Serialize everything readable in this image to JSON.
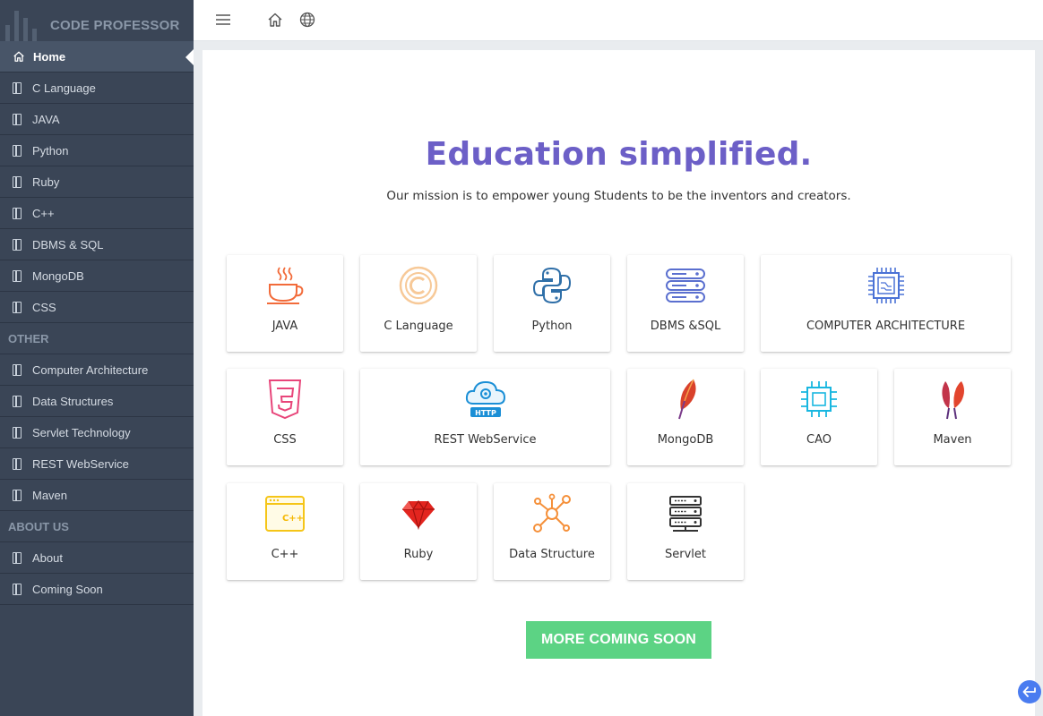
{
  "brand": {
    "name": "CODE PROFESSOR"
  },
  "sidebar": {
    "items_main": [
      {
        "label": "Home",
        "icon": "home-icon"
      },
      {
        "label": "C Language",
        "icon": "book-icon"
      },
      {
        "label": "JAVA",
        "icon": "book-icon"
      },
      {
        "label": "Python",
        "icon": "book-icon"
      },
      {
        "label": "Ruby",
        "icon": "book-icon"
      },
      {
        "label": "C++",
        "icon": "book-icon"
      },
      {
        "label": "DBMS & SQL",
        "icon": "book-icon"
      },
      {
        "label": "MongoDB",
        "icon": "book-icon"
      },
      {
        "label": "CSS",
        "icon": "book-icon"
      }
    ],
    "section_other": "OTHER",
    "items_other": [
      {
        "label": "Computer Architecture",
        "icon": "book-icon"
      },
      {
        "label": "Data Structures",
        "icon": "book-icon"
      },
      {
        "label": "Servlet Technology",
        "icon": "book-icon"
      },
      {
        "label": "REST WebService",
        "icon": "book-icon"
      },
      {
        "label": "Maven",
        "icon": "book-icon"
      }
    ],
    "section_about": "ABOUT US",
    "items_about": [
      {
        "label": "About",
        "icon": "book-icon"
      },
      {
        "label": "Coming Soon",
        "icon": "book-icon"
      }
    ]
  },
  "topbar": {
    "icons": [
      "menu-icon",
      "home-icon",
      "globe-icon"
    ]
  },
  "main": {
    "headline": "Education simplified.",
    "tagline": "Our mission is to empower young Students to be the inventors and creators.",
    "tiles": [
      {
        "label": "JAVA",
        "icon": "java-cup-icon"
      },
      {
        "label": "C Language",
        "icon": "c-language-icon"
      },
      {
        "label": "Python",
        "icon": "python-icon"
      },
      {
        "label": "DBMS &SQL",
        "icon": "database-icon"
      },
      {
        "label": "COMPUTER ARCHITECTURE",
        "icon": "cpu-chip-icon"
      },
      {
        "label": "CSS",
        "icon": "css-icon"
      },
      {
        "label": "REST WebService",
        "icon": "http-cloud-icon"
      },
      {
        "label": "MongoDB",
        "icon": "mongodb-feather-icon"
      },
      {
        "label": "CAO",
        "icon": "chip-icon"
      },
      {
        "label": "Maven",
        "icon": "maven-feather-icon"
      },
      {
        "label": "C++",
        "icon": "cpp-window-icon"
      },
      {
        "label": "Ruby",
        "icon": "ruby-gem-icon"
      },
      {
        "label": "Data Structure",
        "icon": "network-graph-icon"
      },
      {
        "label": "Servlet",
        "icon": "server-icon"
      }
    ],
    "cta_label": "MORE COMING SOON"
  },
  "colors": {
    "sidebar": "#3a4556",
    "headline": "#6c5fc7",
    "cta": "#5cd384",
    "fab": "#4a7cf0"
  }
}
